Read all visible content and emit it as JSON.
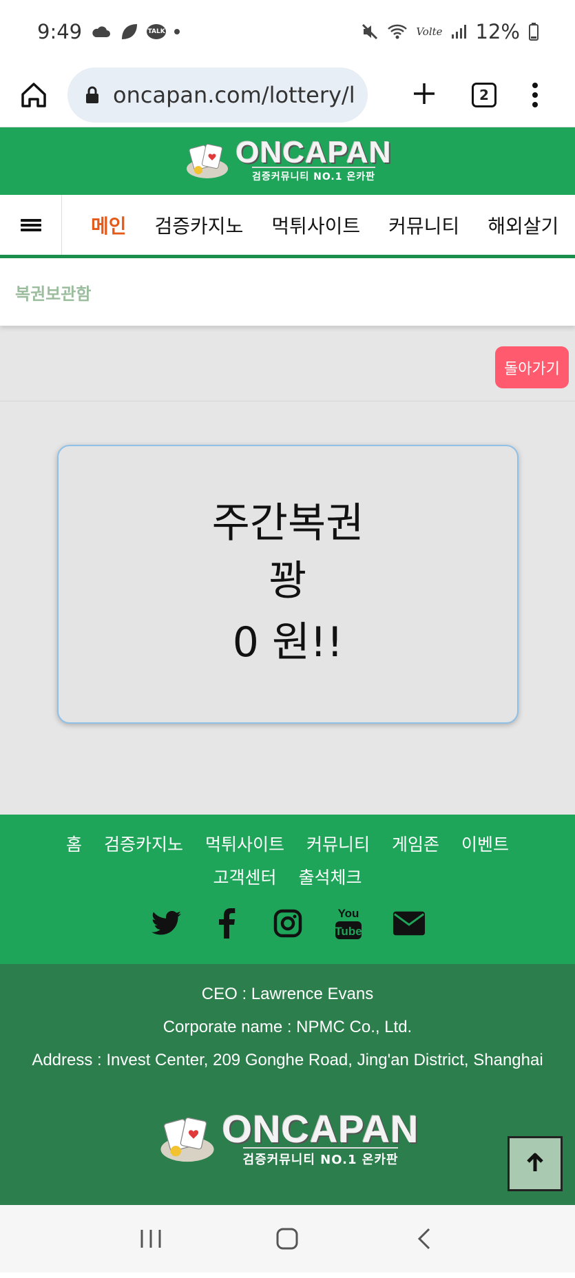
{
  "status_bar": {
    "time": "9:49",
    "talk_badge": "TALK",
    "network": "Volte",
    "battery": "12%"
  },
  "browser": {
    "url": "oncapan.com/lottery/l",
    "tab_count": "2"
  },
  "site": {
    "logo_main": "ONCAPAN",
    "logo_sub": "검증커뮤니티 NO.1 온카판",
    "nav": [
      "메인",
      "검증카지노",
      "먹튀사이트",
      "커뮤니티",
      "해외살기"
    ],
    "breadcrumb": "복권보관함",
    "back_button": "돌아가기"
  },
  "prize": {
    "title": "주간복권",
    "result": "꽝",
    "amount": "0 원!!"
  },
  "footer": {
    "links_row1": [
      "홈",
      "검증카지노",
      "먹튀사이트",
      "커뮤니티",
      "게임존",
      "이벤트"
    ],
    "links_row2": [
      "고객센터",
      "출석체크"
    ],
    "social": [
      "twitter-icon",
      "facebook-icon",
      "instagram-icon",
      "youtube-icon",
      "email-icon"
    ],
    "ceo": "CEO : Lawrence Evans",
    "corporate": "Corporate name : NPMC Co., Ltd.",
    "address": "Address : Invest Center, 209 Gonghe Road, Jing'an District, Shanghai"
  },
  "colors": {
    "green": "#1fa55a",
    "dark_green": "#2c7e4c",
    "accent": "#ff5a6e",
    "active_nav": "#e45a1a"
  }
}
